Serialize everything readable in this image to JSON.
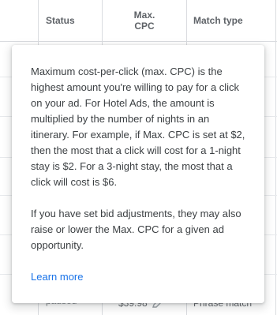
{
  "table": {
    "headers": {
      "status": "Status",
      "max_cpc_line1": "Max.",
      "max_cpc_line2": "CPC",
      "match_type": "Match type"
    },
    "peek_row": {
      "status_line1": "",
      "status_line2": "paused",
      "max_cpc": "$39.98",
      "match_type": "Phrase match",
      "edit_icon": "pencil-icon"
    }
  },
  "popover": {
    "paragraph_1": "Maximum cost-per-click (max. CPC) is the highest amount you're willing to pay for a click on your ad. For Hotel Ads, the amount is multiplied by the number of nights in an itinerary. For example, if Max. CPC is set at $2, then the most that a click will cost for a 1-night stay is $2. For a 3-night stay, the most that a click will cost is $6.",
    "paragraph_2": "If you have set bid adjustments, they may also raise or lower the Max. CPC for a given ad opportunity.",
    "link_label": "Learn more"
  },
  "colors": {
    "link": "#1a73e8",
    "text": "#3c4043",
    "header_text": "#5f6368",
    "divider": "#dadce0"
  }
}
